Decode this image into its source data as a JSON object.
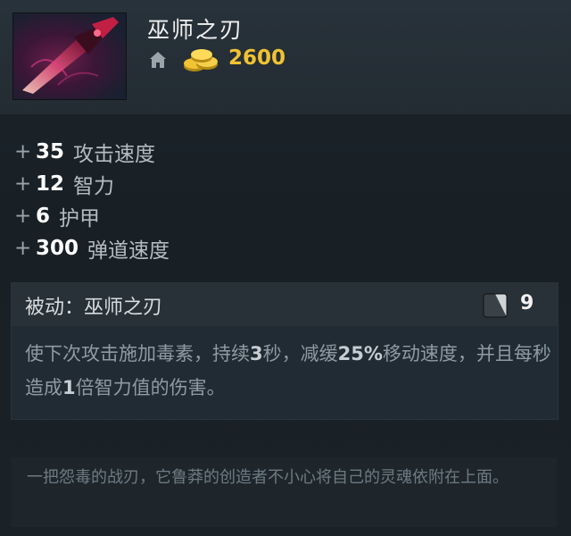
{
  "item": {
    "name": "巫师之刃",
    "gold_cost": "2600",
    "icon": "dagger-icon",
    "shop_icon": "home-icon",
    "gold_icon": "gold-coins-icon"
  },
  "stats": [
    {
      "plus": "+",
      "value": "35",
      "label": "攻击速度"
    },
    {
      "plus": "+",
      "value": "12",
      "label": "智力"
    },
    {
      "plus": "+",
      "value": "6",
      "label": "护甲"
    },
    {
      "plus": "+",
      "value": "300",
      "label": "弹道速度"
    }
  ],
  "ability": {
    "title": "被动：巫师之刃",
    "mana_cost": "9",
    "mana_icon": "mana-icon",
    "desc": {
      "p1": "使下次攻击施加毒素，持续",
      "v1": "3",
      "p2": "秒，减缓",
      "v2": "25%",
      "p3": "移动速度，并且每秒造成",
      "v3": "1",
      "p4": "倍智力值的伤害。"
    }
  },
  "lore": "一把怨毒的战刃，它鲁莽的创造者不小心将自己的灵魂依附在上面。",
  "colors": {
    "gold": "#f1c232",
    "background": "#1b2228",
    "header": "#28323a",
    "ability_panel": "#212b33"
  }
}
